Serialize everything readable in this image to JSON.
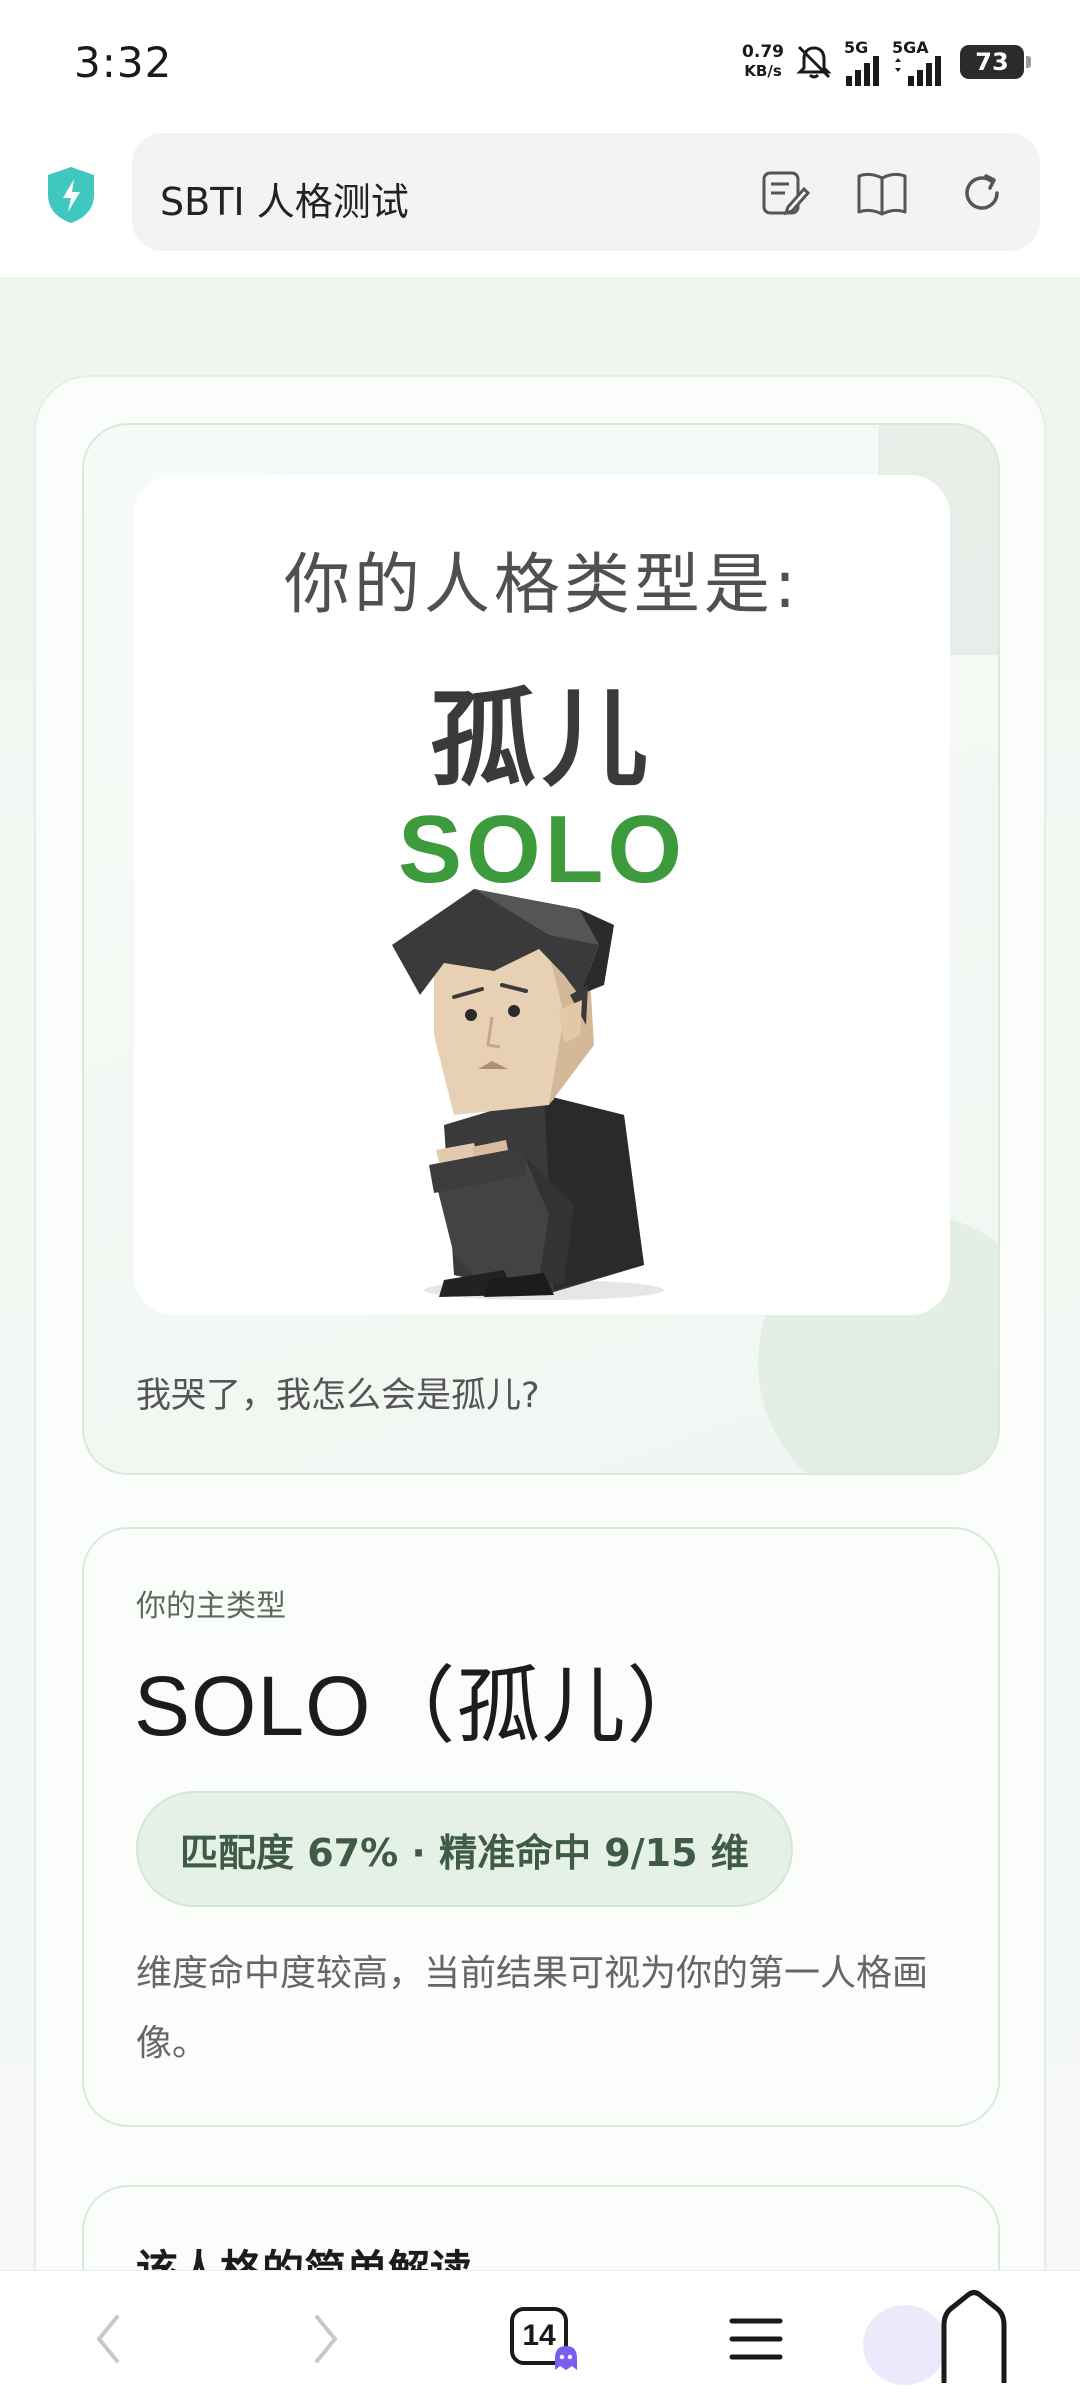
{
  "status_bar": {
    "time": "3:32",
    "net_speed_value": "0.79",
    "net_speed_unit": "KB/s",
    "signal1_label": "5G",
    "signal2_label": "5GA",
    "battery": "73"
  },
  "browser": {
    "page_title": "SBTI 人格测试",
    "tab_count": "14"
  },
  "result": {
    "heading": "你的人格类型是:",
    "type_name": "孤儿",
    "type_code": "SOLO",
    "caption": "我哭了，我怎么会是孤儿?"
  },
  "main_type": {
    "label": "你的主类型",
    "title": "SOLO（孤儿）",
    "match_badge": "匹配度 67% · 精准命中 9/15 维",
    "description": "维度命中度较高，当前结果可视为你的第一人格画像。"
  },
  "brief": {
    "title": "该人格的简单解读"
  },
  "colors": {
    "accent_green": "#3d9a3d",
    "shield_teal": "#3fc7c0",
    "badge_bg": "#e5f1e7"
  }
}
